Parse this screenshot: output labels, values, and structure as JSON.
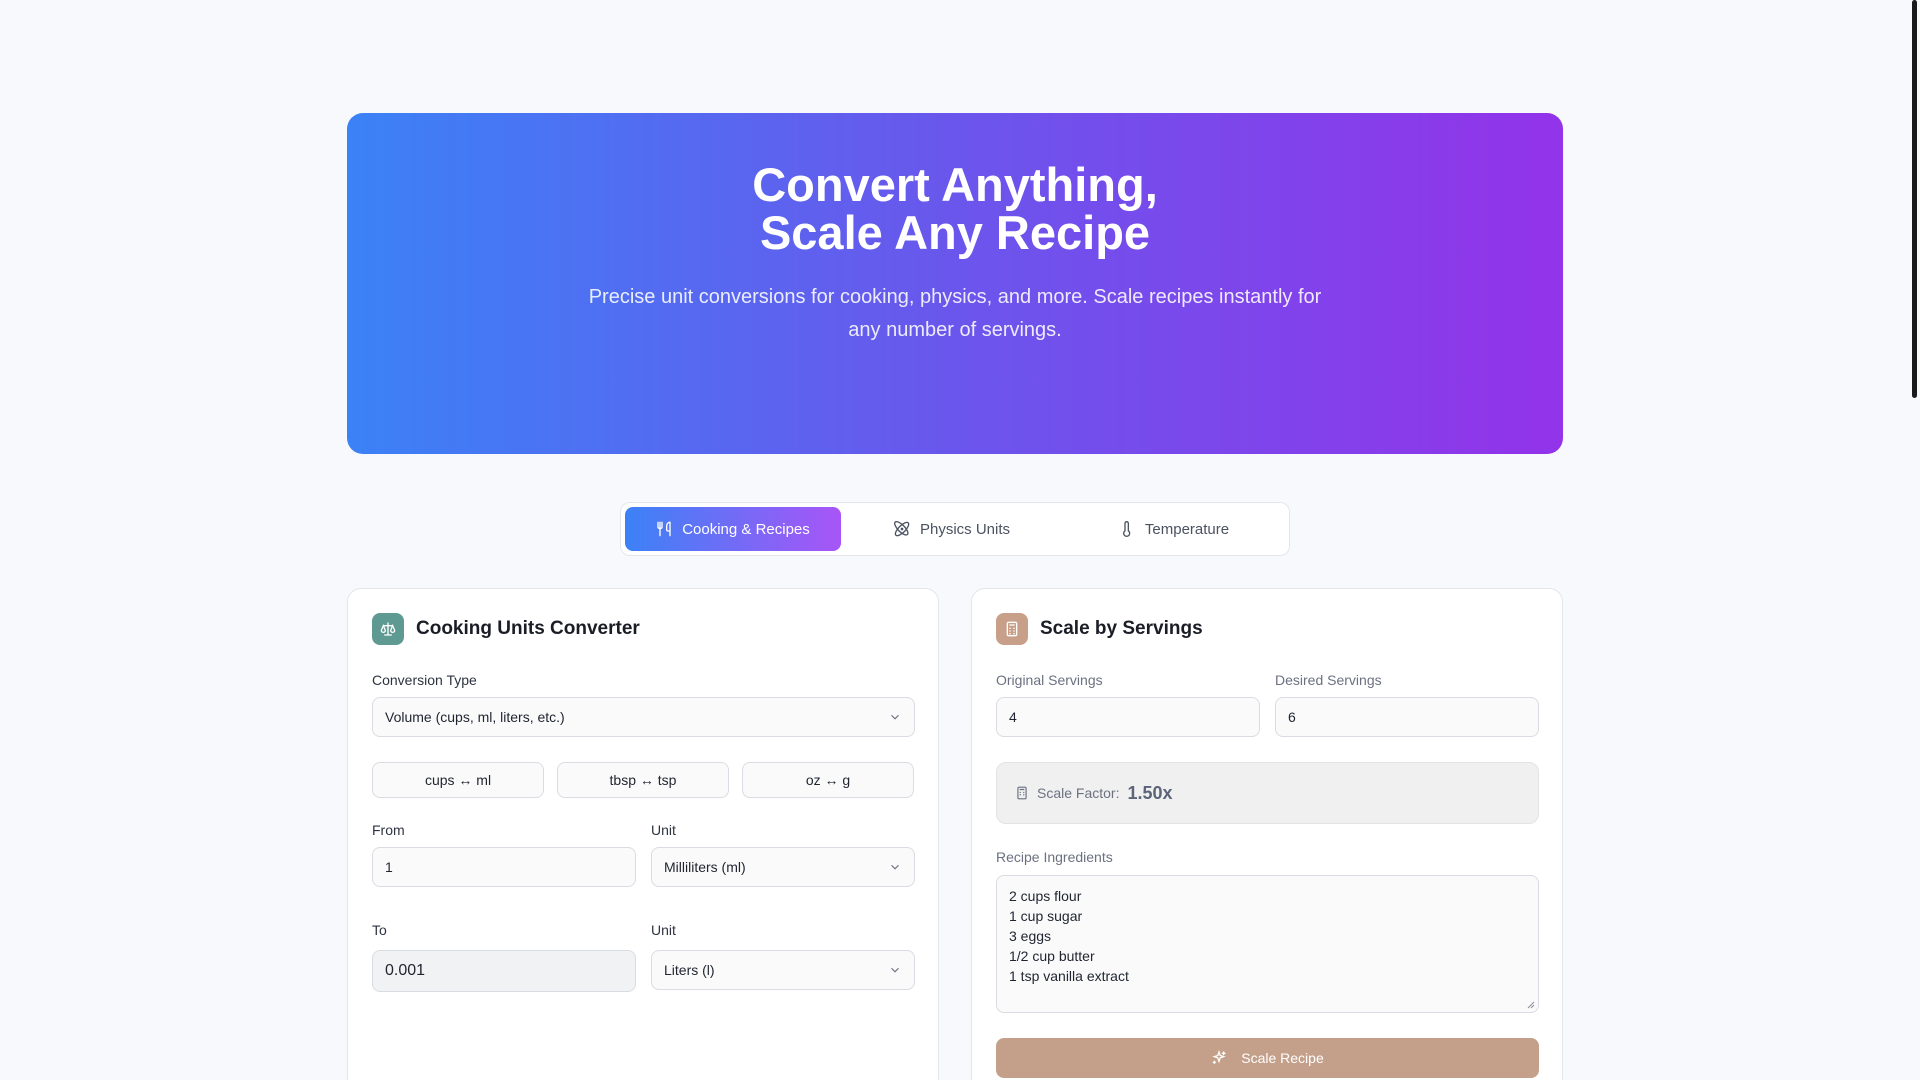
{
  "hero": {
    "title_line1": "Convert Anything,",
    "title_line2": "Scale Any Recipe",
    "subtitle": "Precise unit conversions for cooking, physics, and more. Scale recipes instantly for any number of servings."
  },
  "tabs": [
    {
      "label": "Cooking & Recipes",
      "icon": "utensils-icon",
      "active": true
    },
    {
      "label": "Physics Units",
      "icon": "atom-icon",
      "active": false
    },
    {
      "label": "Temperature",
      "icon": "thermometer-icon",
      "active": false
    }
  ],
  "converter": {
    "title": "Cooking Units Converter",
    "icon": "scale-icon",
    "conversion_type_label": "Conversion Type",
    "conversion_type_value": "Volume (cups, ml, liters, etc.)",
    "quick_buttons": [
      "cups ↔ ml",
      "tbsp ↔ tsp",
      "oz ↔ g"
    ],
    "from_label": "From",
    "from_value": "1",
    "from_unit_label": "Unit",
    "from_unit_value": "Milliliters (ml)",
    "to_label": "To",
    "to_value": "0.001",
    "to_unit_label": "Unit",
    "to_unit_value": "Liters (l)"
  },
  "scaler": {
    "title": "Scale by Servings",
    "icon": "calculator-icon",
    "original_label": "Original Servings",
    "original_value": "4",
    "desired_label": "Desired Servings",
    "desired_value": "6",
    "factor_label": "Scale Factor:",
    "factor_value": "1.50x",
    "ingredients_label": "Recipe Ingredients",
    "ingredients": [
      "2 cups flour",
      "1 cup sugar",
      "3 eggs",
      "1/2 cup butter",
      "1 tsp vanilla extract"
    ],
    "button_label": "Scale Recipe"
  },
  "colors": {
    "hero_gradient_start": "#3b82f6",
    "hero_gradient_end": "#9333ea",
    "converter_badge": "#5f9a92",
    "scaler_badge": "#c8a089",
    "scale_button": "#c4a08a"
  }
}
